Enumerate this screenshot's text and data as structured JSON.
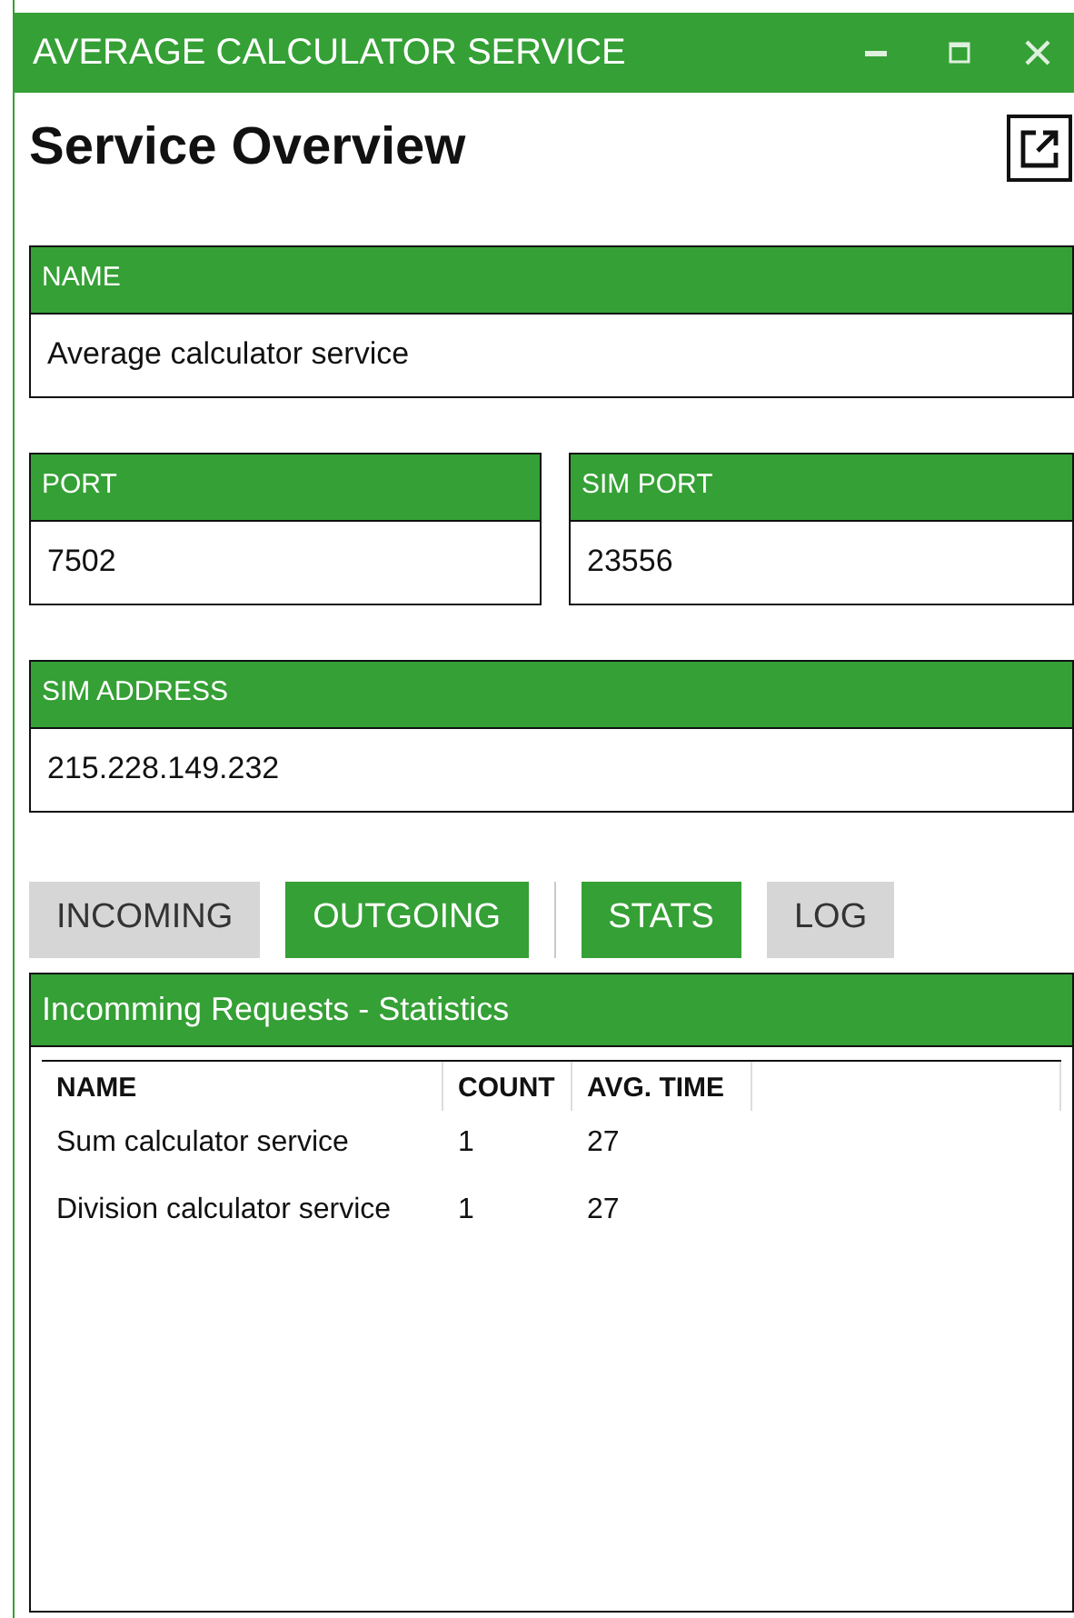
{
  "window": {
    "title": "AVERAGE CALCULATOR SERVICE"
  },
  "heading": "Service Overview",
  "fields": [
    {
      "label": "NAME",
      "value": "Average calculator service"
    },
    {
      "label": "PORT",
      "value": "7502"
    },
    {
      "label": "SIM PORT",
      "value": "23556"
    },
    {
      "label": "SIM ADDRESS",
      "value": "215.228.149.232"
    }
  ],
  "direction_tabs": [
    {
      "label": "INCOMING",
      "selected": false
    },
    {
      "label": "OUTGOING",
      "selected": true
    }
  ],
  "view_tabs": [
    {
      "label": "STATS",
      "selected": true
    },
    {
      "label": "LOG",
      "selected": false
    }
  ],
  "panel": {
    "title": "Incomming Requests - Statistics",
    "table": {
      "columns": [
        "NAME",
        "COUNT",
        "AVG. TIME"
      ],
      "rows": [
        [
          "Sum calculator service",
          "1",
          "27"
        ],
        [
          "Division calculator service",
          "1",
          "27"
        ]
      ]
    }
  }
}
